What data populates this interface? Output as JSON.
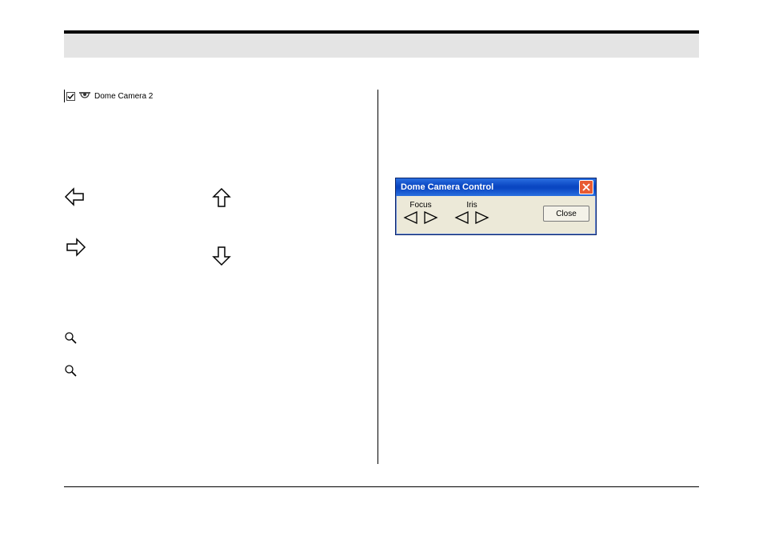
{
  "tree": {
    "camera_label": "Dome Camera 2"
  },
  "dialog": {
    "title": "Dome Camera Control",
    "focus_label": "Focus",
    "iris_label": "Iris",
    "close_label": "Close"
  }
}
